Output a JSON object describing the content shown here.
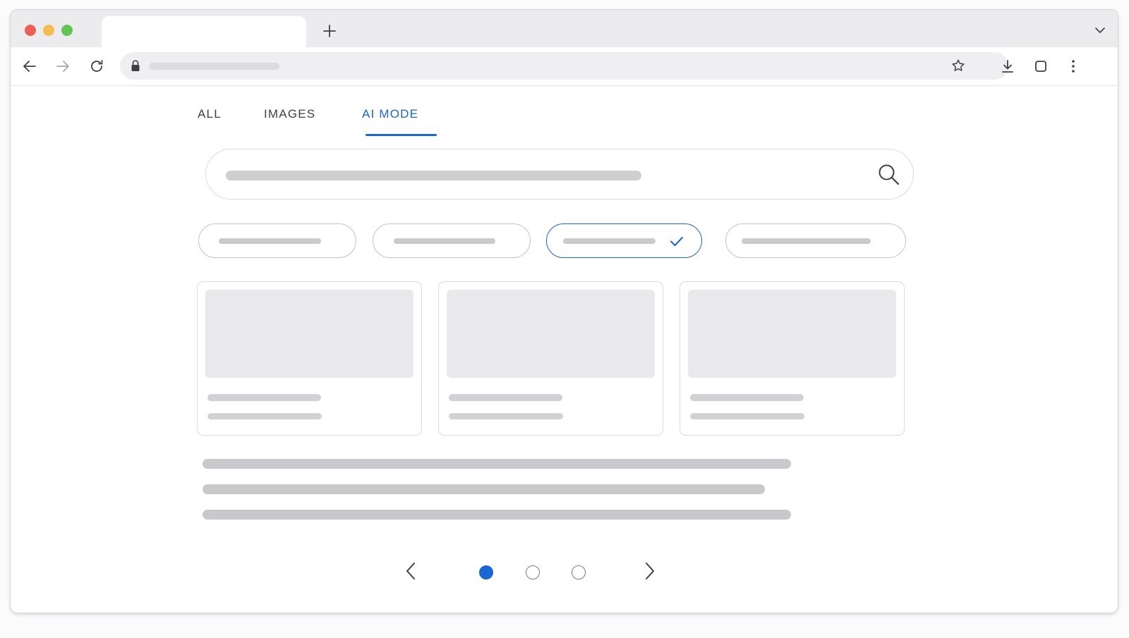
{
  "browser": {
    "tab_title": "",
    "url": "",
    "controls": [
      "back-arrow-icon",
      "forward-arrow-icon",
      "reload-icon",
      "lock-icon",
      "bookmark-star-icon",
      "download-icon",
      "tab-view-icon",
      "more-vert-icon",
      "new-tab-plus-icon",
      "tab-list-chevron-icon"
    ]
  },
  "nav_tabs": [
    {
      "label": "ALL",
      "active": false
    },
    {
      "label": "IMAGES",
      "active": false
    },
    {
      "label": "AI MODE",
      "active": true
    }
  ],
  "search": {
    "value": "",
    "icon": "search-icon"
  },
  "filter_chips": [
    {
      "label": "",
      "selected": false
    },
    {
      "label": "",
      "selected": false
    },
    {
      "label": "",
      "selected": true
    },
    {
      "label": "",
      "selected": false
    }
  ],
  "result_cards": [
    {
      "title": "",
      "subtitle": ""
    },
    {
      "title": "",
      "subtitle": ""
    },
    {
      "title": "",
      "subtitle": ""
    }
  ],
  "summary_lines": [
    "",
    "",
    ""
  ],
  "pagination": {
    "pages": 3,
    "current": 1
  },
  "colors": {
    "accent": "#1a66d2",
    "skeleton": "#cfcfd2",
    "card_image": "#e9e9eb"
  }
}
